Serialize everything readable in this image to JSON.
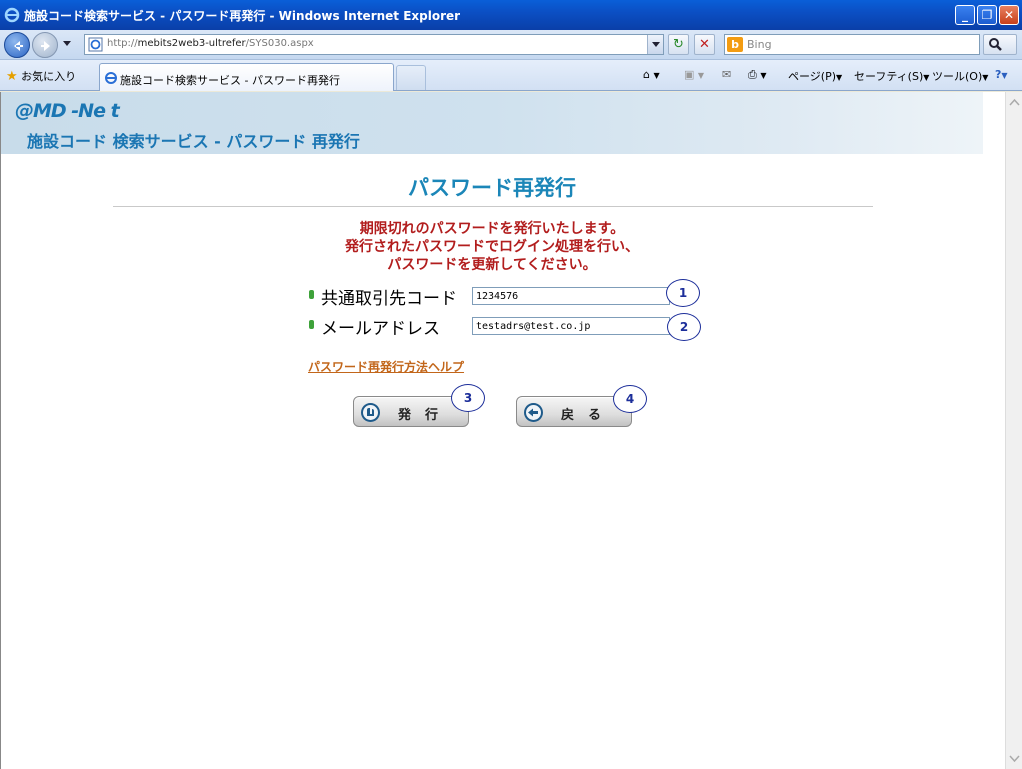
{
  "window": {
    "title": "施設コード検索サービス - パスワード再発行 - Windows Internet Explorer",
    "minimize_label": "_",
    "maximize_label": "❐",
    "close_label": "✕"
  },
  "address_bar": {
    "url_prefix": "http://",
    "url_host": "mebits2web3-ultrefer",
    "url_path": "/SYS030.aspx",
    "refresh_label": "↻",
    "stop_label": "✕"
  },
  "search": {
    "placeholder": "Bing",
    "logo": "b"
  },
  "favorites_bar": {
    "favorites_label": "お気に入り",
    "tab_label": "施設コード検索サービス - パスワード再発行",
    "commands": [
      "ページ(P)",
      "セーフティ(S)",
      "ツール(O)"
    ]
  },
  "page": {
    "brand": "@MD -Ne t",
    "subtitle": "施設コード 検索サービス - パスワード 再発行",
    "title": "パスワード再発行",
    "notice_lines": [
      "期限切れのパスワードを発行いたします。",
      "発行されたパスワードでログイン処理を行い、",
      "パスワードを更新してください。"
    ],
    "fields": [
      {
        "label": "共通取引先コード",
        "value": "1234576",
        "marker": "1"
      },
      {
        "label": "メールアドレス",
        "value": "testadrs@test.co.jp",
        "marker": "2"
      }
    ],
    "help_link": "パスワード再発行方法ヘルプ",
    "buttons": [
      {
        "label": "発行",
        "marker": "3"
      },
      {
        "label": "戻る",
        "marker": "4"
      }
    ]
  },
  "colors": {
    "brand": "#1b76b3",
    "title": "#1b86b8",
    "notice": "#b21d1d",
    "link": "#c2661a",
    "marker": "#1c2e9a"
  }
}
